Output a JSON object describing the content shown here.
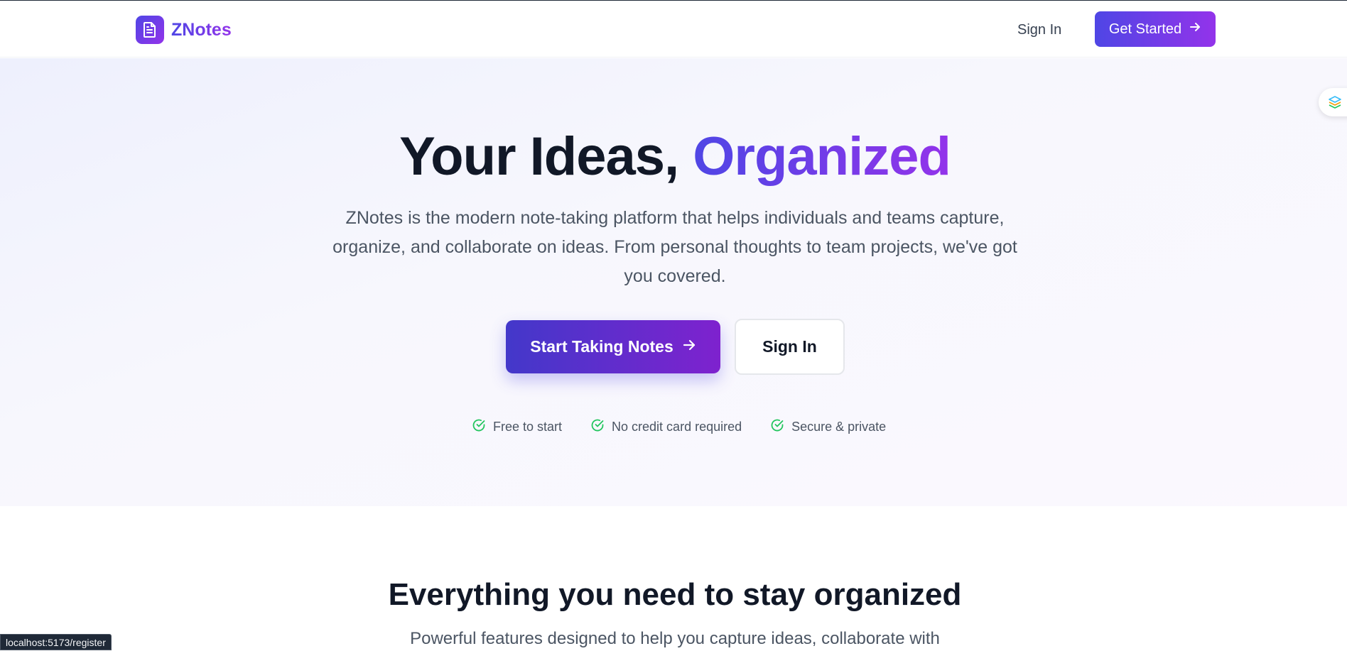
{
  "brand": {
    "name": "ZNotes"
  },
  "nav": {
    "signin_label": "Sign In",
    "cta_label": "Get Started"
  },
  "hero": {
    "title_plain": "Your Ideas, ",
    "title_accent": "Organized",
    "subtitle": "ZNotes is the modern note-taking platform that helps individuals and teams capture, organize, and collaborate on ideas. From personal thoughts to team projects, we've got you covered.",
    "primary_label": "Start Taking Notes",
    "secondary_label": "Sign In",
    "perks": [
      "Free to start",
      "No credit card required",
      "Secure & private"
    ]
  },
  "features": {
    "title": "Everything you need to stay organized",
    "subtitle": "Powerful features designed to help you capture ideas, collaborate with"
  },
  "status_bar": {
    "url": "localhost:5173/register"
  },
  "colors": {
    "accent_start": "#4f46e5",
    "accent_end": "#9333ea",
    "check": "#22c55e"
  },
  "icons": {
    "logo": "document-icon",
    "arrow": "arrow-right-icon",
    "perk": "check-circle-icon",
    "floating": "extension-icon"
  }
}
